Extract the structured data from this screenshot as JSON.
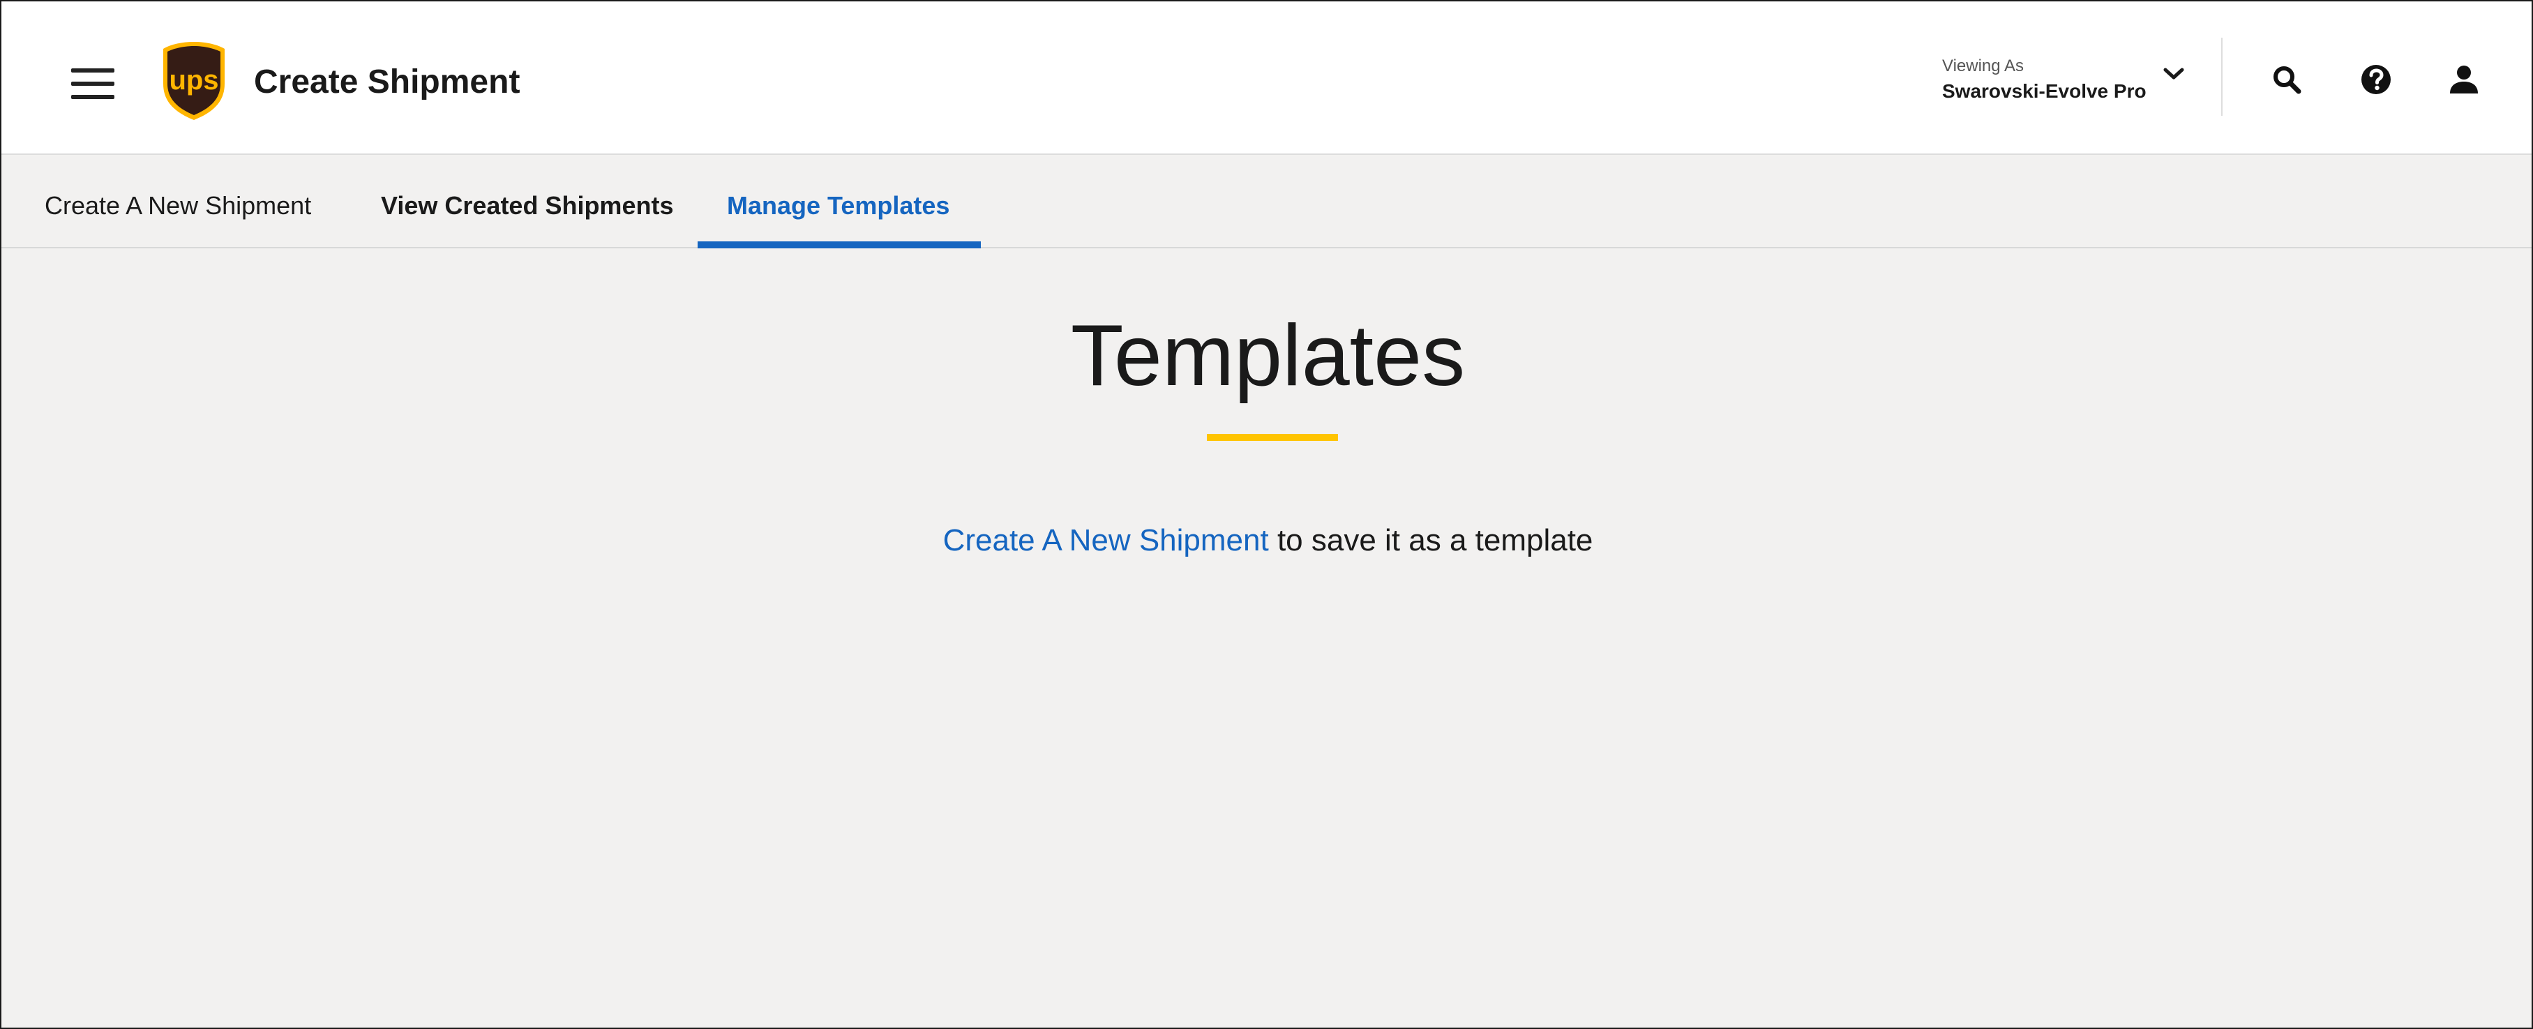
{
  "header": {
    "app_title": "Create Shipment",
    "logo_text": "ups",
    "viewing_label": "Viewing As",
    "viewing_value": "Swarovski-Evolve Pro",
    "icons": [
      "menu-icon",
      "ups-logo",
      "chevron-down-icon",
      "search-icon",
      "help-icon",
      "profile-icon"
    ]
  },
  "tabs": [
    {
      "label": "Create A New Shipment",
      "active": false
    },
    {
      "label": "View Created Shipments",
      "active": false
    },
    {
      "label": "Manage Templates",
      "active": true
    }
  ],
  "main": {
    "title": "Templates",
    "link_text": "Create A New Shipment",
    "message_suffix": " to save it as a template"
  },
  "colors": {
    "accent_blue": "#1565c0",
    "accent_yellow": "#ffc400",
    "ups_brown": "#351c15",
    "ups_gold": "#ffb500",
    "background": "#f2f1f0"
  }
}
